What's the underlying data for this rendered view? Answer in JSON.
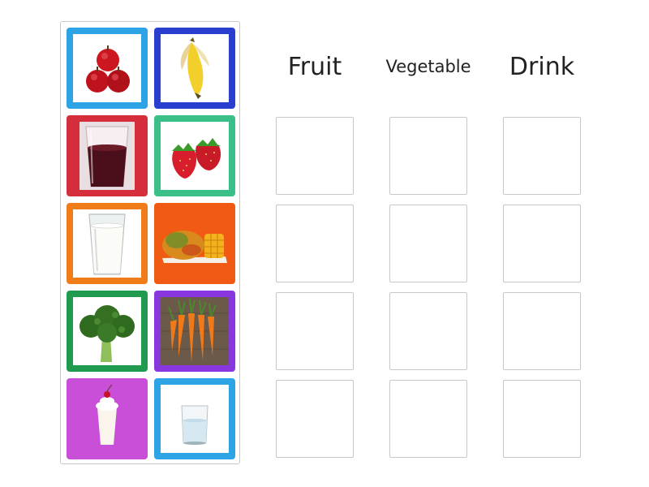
{
  "headers": {
    "fruit": "Fruit",
    "vegetable": "Vegetable",
    "drink": "Drink"
  },
  "tiles": [
    {
      "item": "apples-image",
      "color": "#2ea3e6"
    },
    {
      "item": "banana-image",
      "color": "#2a3fcf"
    },
    {
      "item": "juice-cup-image",
      "color": "#d62d3c"
    },
    {
      "item": "strawberries-image",
      "color": "#3bbf88"
    },
    {
      "item": "milk-glass-image",
      "color": "#f07d1a"
    },
    {
      "item": "mango-image",
      "color": "#f05a12"
    },
    {
      "item": "broccoli-image",
      "color": "#1f9a4e"
    },
    {
      "item": "carrots-image",
      "color": "#8a36e0"
    },
    {
      "item": "milkshake-image",
      "color": "#c94fd8"
    },
    {
      "item": "water-glass-image",
      "color": "#2ea3e6"
    }
  ],
  "grid": {
    "rows": 4,
    "columns": [
      "Fruit",
      "Vegetable",
      "Drink"
    ]
  }
}
